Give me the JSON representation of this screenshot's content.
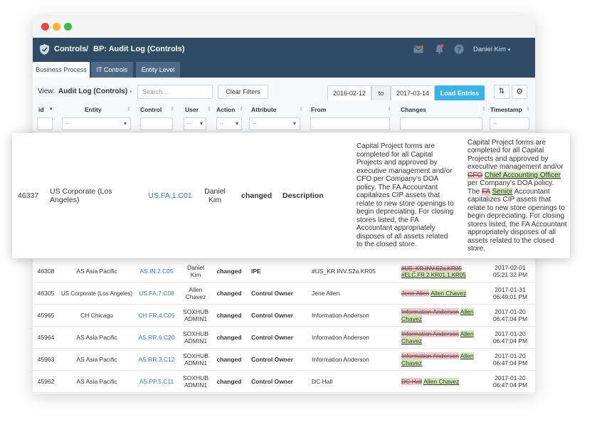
{
  "app": {
    "breadcrumb_root": "Controls",
    "separator": "/",
    "page_title": "BP: Audit Log (Controls)",
    "user_name": "Daniel Kim"
  },
  "tabs": [
    {
      "label": "Business Process"
    },
    {
      "label": "IT Controls"
    },
    {
      "label": "Entity Level"
    }
  ],
  "toolbar": {
    "view_label": "View:",
    "view_value": "Audit Log (Controls)",
    "search_placeholder": "Search...",
    "clear_filters": "Clear Filters",
    "date_from": "2016-02-12",
    "date_to_label": "to",
    "date_to": "2017-03-14",
    "load_entries": "Load Entries"
  },
  "columns": [
    {
      "label": "id"
    },
    {
      "label": "Entity"
    },
    {
      "label": "Control"
    },
    {
      "label": "User"
    },
    {
      "label": "Action"
    },
    {
      "label": "Attribute"
    },
    {
      "label": "From"
    },
    {
      "label": "Changes"
    },
    {
      "label": "Timestamp"
    }
  ],
  "filters": {
    "placeholder": "--"
  },
  "expanded": {
    "id": "46337",
    "entity": "US Corporate (Los Angeles)",
    "control": "US.FA.1.C01",
    "user": "Daniel Kim",
    "action": "changed",
    "attribute": "Description",
    "from": "Capital Project forms are completed for all Capital Projects and approved by executive management and/or CFO per Company's DOA policy. The FA Accountant capitalizes CIP assets that relate to new store openings to begin depreciating. For closing stores listed, the FA Accountant appropriately disposes of all assets related to the closed store.",
    "changes": {
      "p1": "Capital Project forms are completed for all Capital Projects and approved by executive management and/or",
      "del1": "CFO",
      "ins1": "Chief Accounting Officer",
      "p2": "per Company's DOA policy. The",
      "del2": "FA",
      "ins2": "Senior",
      "p3": "Accountant capitalizes CIP assets that relate to new store openings to begin depreciating. For closing stores listed, the FA Accountant appropriately disposes of all assets related to the closed store."
    }
  },
  "rows": [
    {
      "id": "46308",
      "entity": "AS Asia Pacific",
      "control": "AS.IN.2.C05",
      "user": "Daniel Kim",
      "action": "changed",
      "attribute": "IPE",
      "from": "#US_KR.INV.S2a.KR05",
      "del": "#US_KR.INV.S2a.KR05",
      "ins": "#ELC.FR.2.KR01.1.KR05",
      "date": "2017-02-01",
      "time": "05:21:32 PM"
    },
    {
      "id": "46305",
      "entity": "US Corporate (Los Angeles)",
      "control": "US.FA.7.C08",
      "user": "Allen Chavez",
      "action": "changed",
      "attribute": "Control Owner",
      "from": "Jene Allen",
      "del": "Jene Allen",
      "ins": "Allen Chavez",
      "date": "2017-01-31",
      "time": "06:49:01 PM"
    },
    {
      "id": "45965",
      "entity": "CH Chicago",
      "control": "CH.FR.4.C05",
      "user": "SOXHUB ADMIN1",
      "action": "changed",
      "attribute": "Control Owner",
      "from": "Information Anderson",
      "del": "Information Anderson",
      "ins": "Allen Chavez",
      "date": "2017-01-20",
      "time": "06:47:04 PM"
    },
    {
      "id": "45964",
      "entity": "AS Asia Pacific",
      "control": "AS.RR.6.C20",
      "user": "SOXHUB ADMIN1",
      "action": "changed",
      "attribute": "Control Owner",
      "from": "Information Anderson",
      "del": "Information Anderson",
      "ins": "Allen Chavez",
      "date": "2017-01-20",
      "time": "06:47:04 PM"
    },
    {
      "id": "45963",
      "entity": "AS Asia Pacific",
      "control": "AS.RR.3.C12",
      "user": "SOXHUB ADMIN1",
      "action": "changed",
      "attribute": "Control Owner",
      "from": "Information Anderson",
      "del": "Information Anderson",
      "ins": "Allen Chavez",
      "date": "2017-01-20",
      "time": "06:47:04 PM"
    },
    {
      "id": "45962",
      "entity": "AS Asia Pacific",
      "control": "AS.PP.5.C11",
      "user": "SOXHUB ADMIN1",
      "action": "changed",
      "attribute": "Control Owner",
      "from": "DC Hall",
      "del": "DC Hall",
      "ins": "Allen Chavez",
      "date": "2017-01-20",
      "time": "06:47:04 PM"
    }
  ],
  "colors": {
    "header_bg": "#2f4b66",
    "accent": "#3ab4e8",
    "link": "#2a7ac0",
    "del_bg": "#f8c6c6",
    "ins_bg": "#cdeab0",
    "dot_red": "#e9463f",
    "dot_yellow": "#f3b52b",
    "dot_green": "#34c24a"
  }
}
